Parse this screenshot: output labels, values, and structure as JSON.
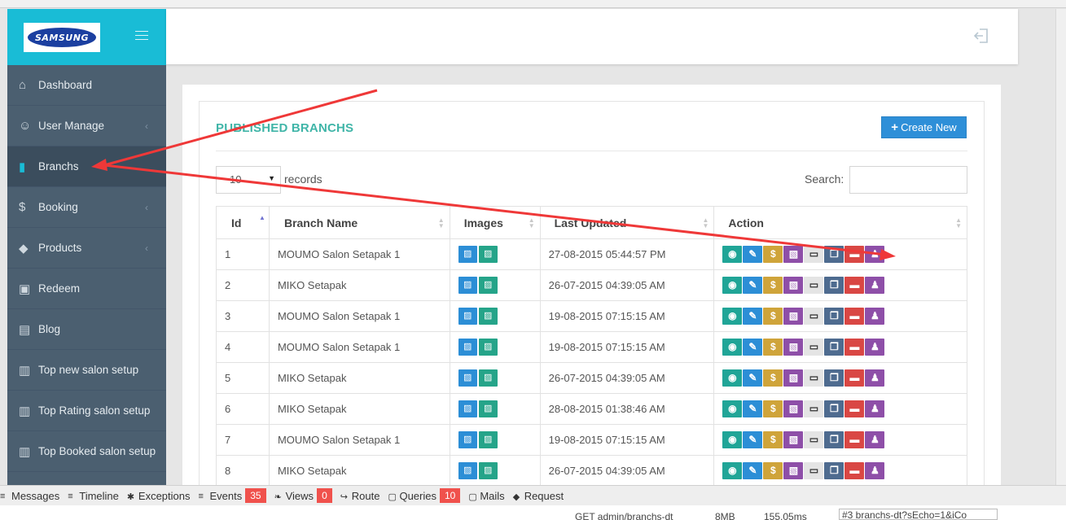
{
  "brand": {
    "logo_text": "SAMSUNG",
    "accent": "#19bcd6",
    "sidebar_bg": "#4b5f70"
  },
  "sidebar": {
    "items": [
      {
        "label": "Dashboard",
        "icon": "home-icon",
        "has_children": false,
        "active": false
      },
      {
        "label": "User Manage",
        "icon": "users-icon",
        "has_children": true,
        "active": false
      },
      {
        "label": "Branchs",
        "icon": "building-icon",
        "has_children": false,
        "active": true
      },
      {
        "label": "Booking",
        "icon": "dollar-icon",
        "has_children": true,
        "active": false
      },
      {
        "label": "Products",
        "icon": "tags-icon",
        "has_children": true,
        "active": false
      },
      {
        "label": "Redeem",
        "icon": "gift-icon",
        "has_children": false,
        "active": false
      },
      {
        "label": "Blog",
        "icon": "book-icon",
        "has_children": false,
        "active": false
      },
      {
        "label": "Top new salon setup",
        "icon": "bar-chart-icon",
        "has_children": false,
        "active": false
      },
      {
        "label": "Top Rating salon setup",
        "icon": "bar-chart-icon",
        "has_children": false,
        "active": false
      },
      {
        "label": "Top Booked salon setup",
        "icon": "bar-chart-icon",
        "has_children": false,
        "active": false
      }
    ]
  },
  "panel": {
    "title": "PUBLISHED BRANCHS",
    "create_label": "Create New",
    "length_value": "10",
    "length_suffix": "records",
    "search_label": "Search:"
  },
  "table": {
    "columns": [
      "Id",
      "Branch Name",
      "Images",
      "Last Updated",
      "Action"
    ],
    "rows": [
      {
        "id": "1",
        "name": "MOUMO Salon Setapak 1",
        "updated": "27-08-2015 05:44:57 PM"
      },
      {
        "id": "2",
        "name": "MIKO Setapak",
        "updated": "26-07-2015 04:39:05 AM"
      },
      {
        "id": "3",
        "name": "MOUMO Salon Setapak 1",
        "updated": "19-08-2015 07:15:15 AM"
      },
      {
        "id": "4",
        "name": "MOUMO Salon Setapak 1",
        "updated": "19-08-2015 07:15:15 AM"
      },
      {
        "id": "5",
        "name": "MIKO Setapak",
        "updated": "26-07-2015 04:39:05 AM"
      },
      {
        "id": "6",
        "name": "MIKO Setapak",
        "updated": "28-08-2015 01:38:46 AM"
      },
      {
        "id": "7",
        "name": "MOUMO Salon Setapak 1",
        "updated": "19-08-2015 07:15:15 AM"
      },
      {
        "id": "8",
        "name": "MIKO Setapak",
        "updated": "26-07-2015 04:39:05 AM"
      }
    ],
    "action_icons": [
      "eye-icon",
      "pencil-icon",
      "dollar-icon",
      "image-icon",
      "money-icon",
      "copy-icon",
      "trash-icon",
      "users-icon"
    ],
    "image_icons": [
      "picture-icon",
      "picture-file-icon"
    ]
  },
  "debugbar": {
    "tabs": [
      {
        "label": "Messages",
        "badge": ""
      },
      {
        "label": "Timeline",
        "badge": ""
      },
      {
        "label": "Exceptions",
        "badge": ""
      },
      {
        "label": "Events",
        "badge": "35"
      },
      {
        "label": "Views",
        "badge": "0"
      },
      {
        "label": "Route",
        "badge": ""
      },
      {
        "label": "Queries",
        "badge": "10"
      },
      {
        "label": "Mails",
        "badge": ""
      },
      {
        "label": "Request",
        "badge": ""
      }
    ],
    "status": {
      "route": "GET admin/branchs-dt",
      "memory": "8MB",
      "time": "155.05ms",
      "request": "#3 branchs-dt?sEcho=1&iCo"
    }
  }
}
